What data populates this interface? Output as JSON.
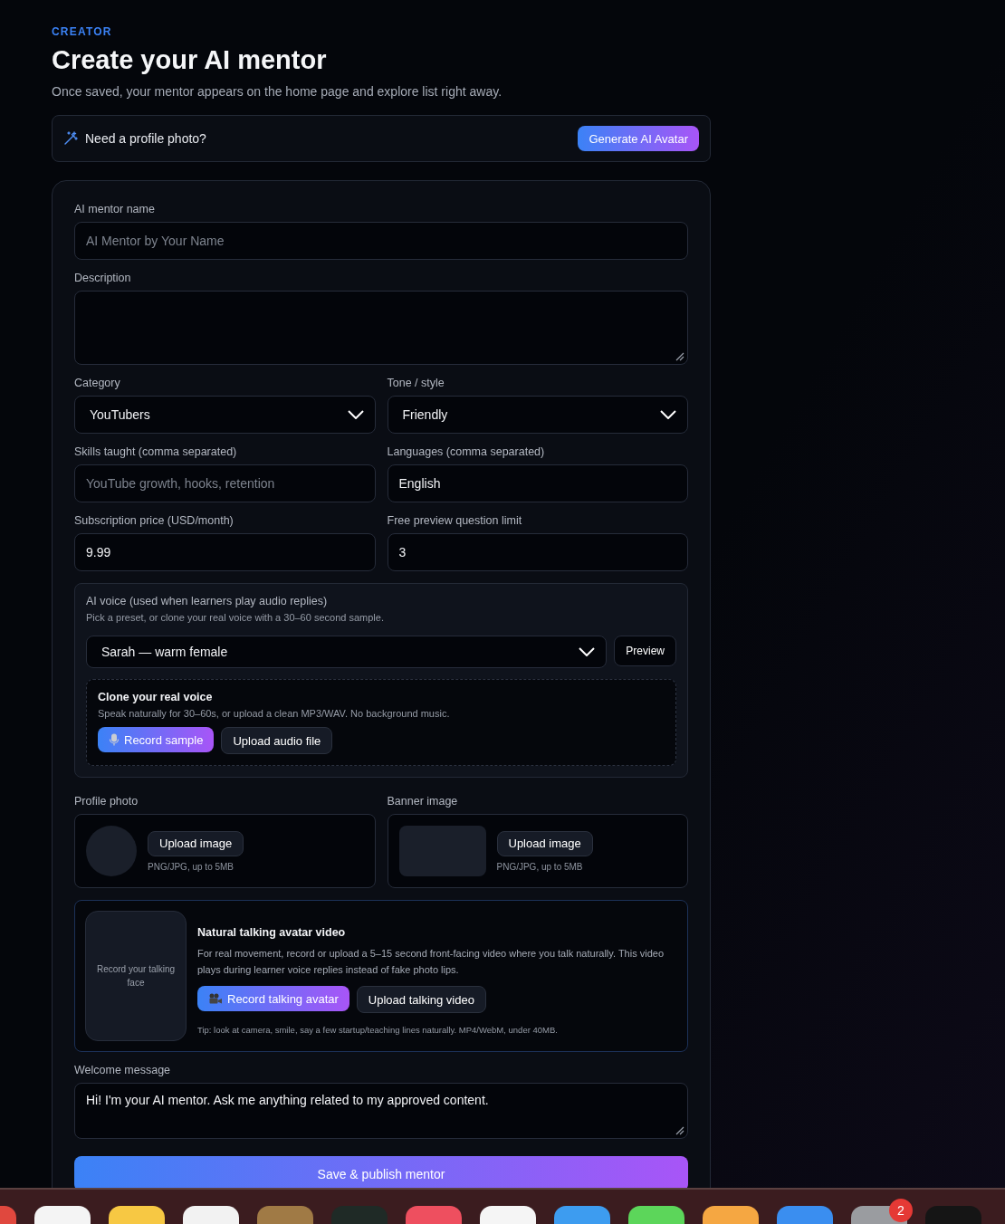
{
  "header": {
    "eyebrow": "CREATOR",
    "title": "Create your AI mentor",
    "subtitle": "Once saved, your mentor appears on the home page and explore list right away."
  },
  "avatar_banner": {
    "text": "Need a profile photo?",
    "button": "Generate AI Avatar"
  },
  "form": {
    "rows": [
      [
        {
          "kind": "input",
          "label": "AI mentor name",
          "placeholder": "AI Mentor by Your Name"
        }
      ],
      [
        {
          "kind": "textarea",
          "label": "Description"
        }
      ],
      [
        {
          "kind": "select",
          "label": "Category",
          "value": "YouTubers"
        },
        {
          "kind": "select",
          "label": "Tone / style",
          "value": "Friendly"
        }
      ],
      [
        {
          "kind": "input",
          "label": "Skills taught (comma separated)",
          "placeholder": "YouTube growth, hooks, retention"
        },
        {
          "kind": "input",
          "label": "Languages (comma separated)",
          "value": "English"
        }
      ],
      [
        {
          "kind": "input",
          "label": "Subscription price (USD/month)",
          "value": "9.99"
        },
        {
          "kind": "input",
          "label": "Free preview question limit",
          "value": "3"
        }
      ]
    ],
    "voice": {
      "title": "AI voice (used when learners play audio replies)",
      "hint": "Pick a preset, or clone your real voice with a 30–60 second sample.",
      "value": "Sarah — warm female",
      "preview_button": "Preview",
      "clone": {
        "title": "Clone your real voice",
        "hint": "Speak naturally for 30–60s, or upload a clean MP3/WAV. No background music.",
        "record_button": "Record sample",
        "upload_button": "Upload audio file"
      }
    },
    "images": [
      {
        "kind": "round",
        "label": "Profile photo",
        "button": "Upload image",
        "hint": "PNG/JPG, up to 5MB"
      },
      {
        "kind": "wide",
        "label": "Banner image",
        "button": "Upload image",
        "hint": "PNG/JPG, up to 5MB"
      }
    ],
    "talking_video": {
      "preview_text": "Record your talking face",
      "title": "Natural talking avatar video",
      "description": "For real movement, record or upload a 5–15 second front-facing video where you talk naturally. This video plays during learner voice replies instead of fake photo lips.",
      "record_button": "Record talking avatar",
      "upload_button": "Upload talking video",
      "tip": "Tip: look at camera, smile, say a few startup/teaching lines naturally. MP4/WebM, under 40MB."
    },
    "welcome": {
      "label": "Welcome message",
      "value": "Hi! I'm your AI mentor. Ask me anything related to my approved content."
    },
    "submit": "Save & publish mentor"
  },
  "dock": {
    "items": [
      {
        "color": "#e0483e"
      },
      {
        "color": "#f4f4f4"
      },
      {
        "color": "#f7c843"
      },
      {
        "color": "#f2f2f2"
      },
      {
        "color": "#a07a45"
      },
      {
        "color": "#1f2a26"
      },
      {
        "color": "#ee4f5f"
      },
      {
        "color": "#f5f5f5"
      },
      {
        "color": "#3d9cf0"
      },
      {
        "color": "#5cd65a"
      },
      {
        "color": "#f5a742"
      },
      {
        "color": "#3a8ef0"
      },
      {
        "color": "#9a9ca0",
        "badge": "2"
      },
      {
        "color": "#151515"
      }
    ]
  }
}
